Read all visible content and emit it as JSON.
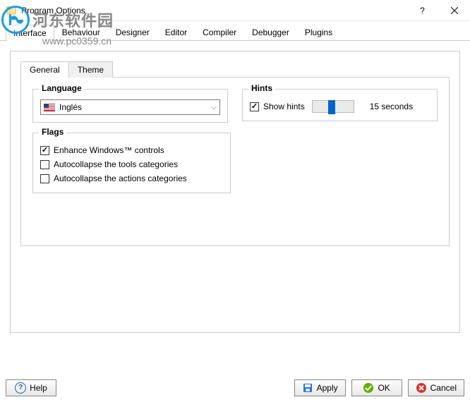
{
  "window": {
    "title": "Program Options"
  },
  "watermark": {
    "text1": "河东软件园",
    "text2": "www.pc0359.cn"
  },
  "main_tabs": [
    "Interface",
    "Behaviour",
    "Designer",
    "Editor",
    "Compiler",
    "Debugger",
    "Plugins"
  ],
  "main_tab_active": 0,
  "sub_tabs": [
    "General",
    "Theme"
  ],
  "sub_tab_active": 0,
  "language": {
    "legend": "Language",
    "selected": "Inglés"
  },
  "hints": {
    "legend": "Hints",
    "checkbox_label": "Show hints",
    "checkbox_checked": true,
    "value_label": "15 seconds"
  },
  "flags": {
    "legend": "Flags",
    "items": [
      {
        "label": "Enhance Windows™ controls",
        "checked": true
      },
      {
        "label": "Autocollapse the tools categories",
        "checked": false
      },
      {
        "label": "Autocollapse the actions categories",
        "checked": false
      }
    ]
  },
  "buttons": {
    "help": "Help",
    "apply": "Apply",
    "ok": "OK",
    "cancel": "Cancel"
  }
}
